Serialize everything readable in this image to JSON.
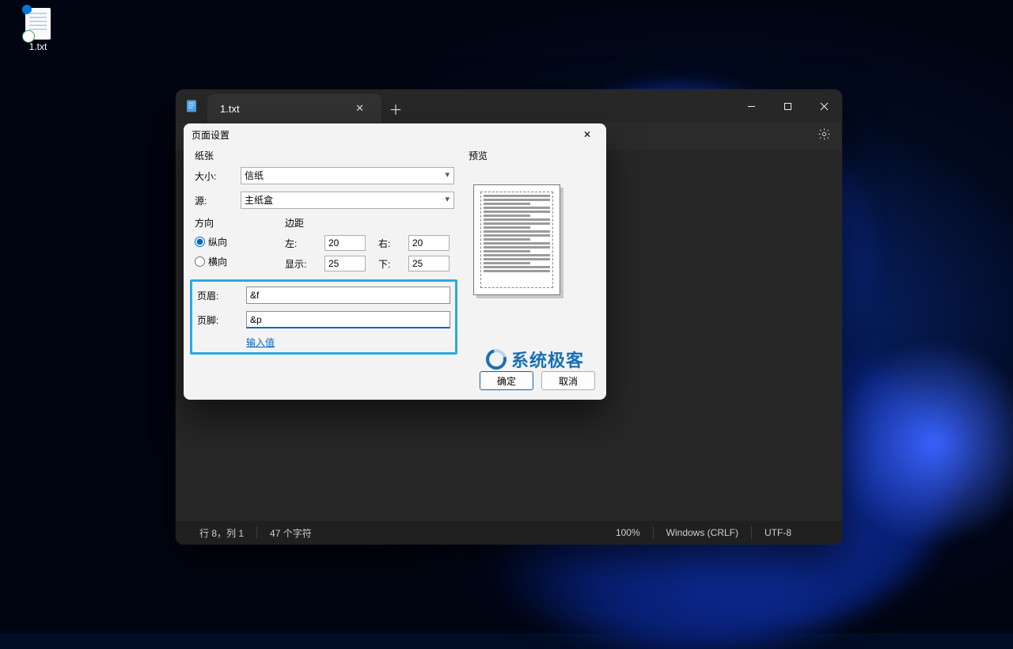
{
  "desktop": {
    "icon_label": "1.txt"
  },
  "window": {
    "tab_title": "1.txt",
    "min_tip": "Minimize",
    "max_tip": "Maximize",
    "close_tip": "Close",
    "status": {
      "position": "行 8，列 1",
      "chars": "47 个字符",
      "zoom": "100%",
      "line_ending": "Windows (CRLF)",
      "encoding": "UTF-8"
    }
  },
  "dialog": {
    "title": "页面设置",
    "paper": {
      "group": "纸张",
      "size_label": "大小:",
      "size_value": "信纸",
      "source_label": "源:",
      "source_value": "主纸盒"
    },
    "orientation": {
      "group": "方向",
      "portrait": "纵向",
      "landscape": "横向",
      "selected": "portrait"
    },
    "margins": {
      "group": "边距",
      "left_label": "左:",
      "left_value": "20",
      "right_label": "右:",
      "right_value": "20",
      "top_label": "显示:",
      "top_value": "25",
      "bottom_label": "下:",
      "bottom_value": "25"
    },
    "header": {
      "label": "页眉:",
      "value": "&f"
    },
    "footer": {
      "label": "页脚:",
      "value": "&p"
    },
    "input_values_link": "输入值",
    "preview_label": "预览",
    "ok": "确定",
    "cancel": "取消"
  },
  "watermark": "系统极客"
}
